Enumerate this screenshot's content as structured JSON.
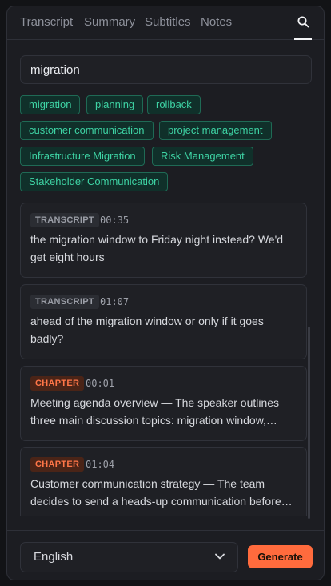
{
  "tabs": [
    "Transcript",
    "Summary",
    "Subtitles",
    "Notes"
  ],
  "search": {
    "value": "migration",
    "icon": "search-icon"
  },
  "tags": [
    "migration",
    "planning",
    "rollback",
    "customer communication",
    "project management",
    "Infrastructure Migration",
    "Risk Management",
    "Stakeholder Communication"
  ],
  "results": [
    {
      "type": "TRANSCRIPT",
      "time": "00:35",
      "text": "the migration window to Friday night instead? We'd get eight hours"
    },
    {
      "type": "TRANSCRIPT",
      "time": "01:07",
      "text": "ahead of the migration window or only if it goes badly?"
    },
    {
      "type": "CHAPTER",
      "time": "00:01",
      "text": "Meeting agenda overview — The speaker outlines three main discussion topics: migration window, rollback plan, and customer communication."
    },
    {
      "type": "CHAPTER",
      "time": "01:04",
      "text": "Customer communication strategy — The team decides to send a heads-up communication before the migration window."
    }
  ],
  "footer": {
    "language": "English",
    "generate_label": "Generate"
  },
  "colors": {
    "accent": "#ff6b3d",
    "tag": "#3ed3a4",
    "chapter": "#ff7648"
  }
}
